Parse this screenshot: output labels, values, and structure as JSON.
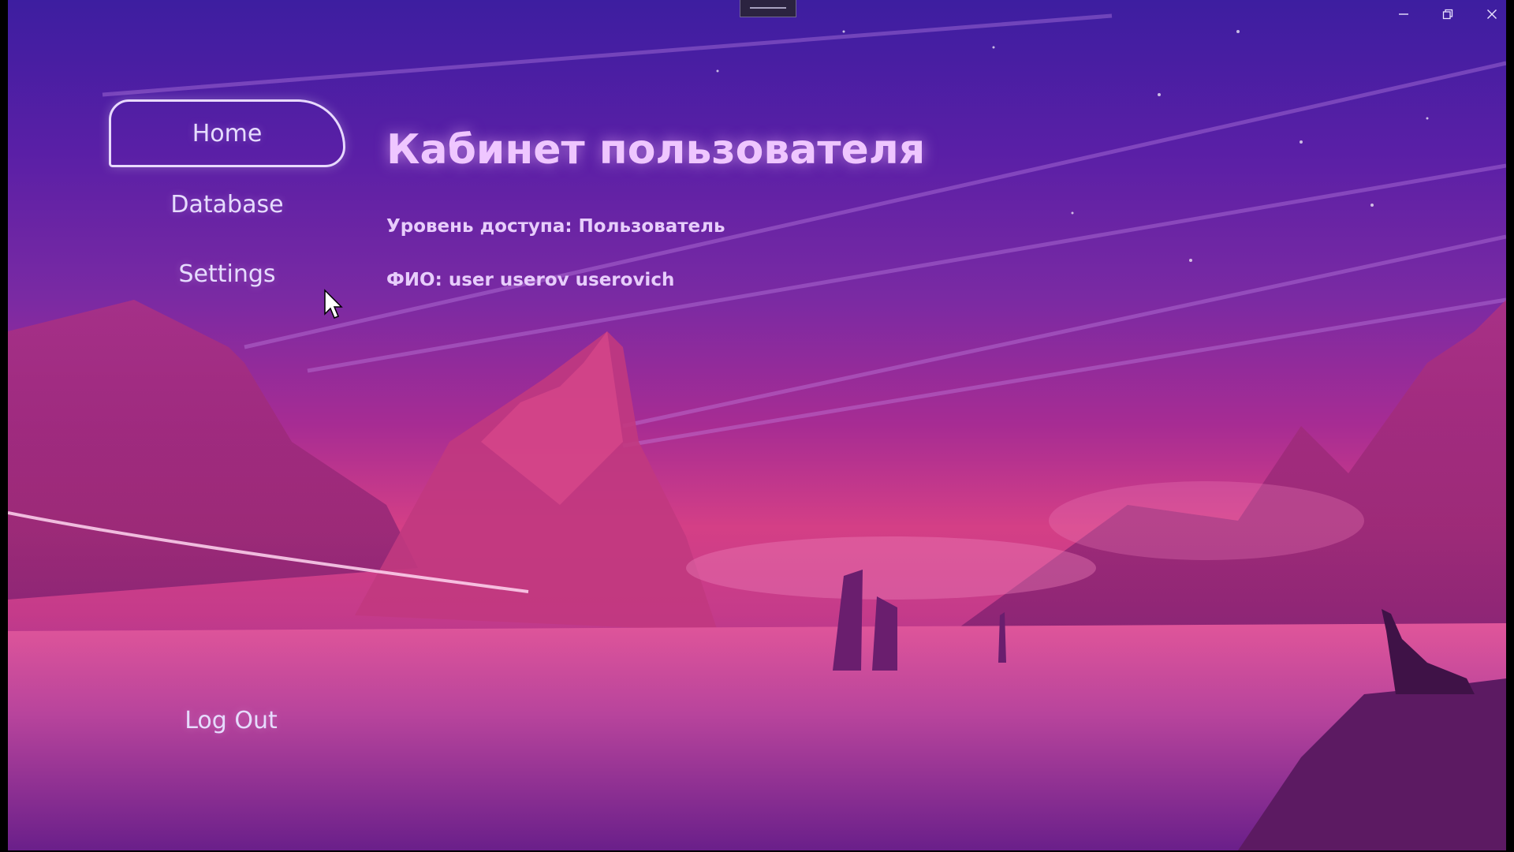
{
  "window": {
    "controls": {
      "minimize_icon": "minimize-icon",
      "maximize_icon": "restore-icon",
      "close_icon": "close-icon"
    }
  },
  "nav": {
    "items": [
      {
        "label": "Home",
        "active": true
      },
      {
        "label": "Database",
        "active": false
      },
      {
        "label": "Settings",
        "active": false
      }
    ],
    "logout_label": "Log Out"
  },
  "main": {
    "title": "Кабинет пользователя",
    "access_level": "Уровень доступа: Пользователь",
    "full_name": "ФИО: user userov userovich"
  },
  "colors": {
    "accent_text": "#efc6ff",
    "nav_text": "#e6dcff",
    "active_border": "#e8d9ff"
  }
}
